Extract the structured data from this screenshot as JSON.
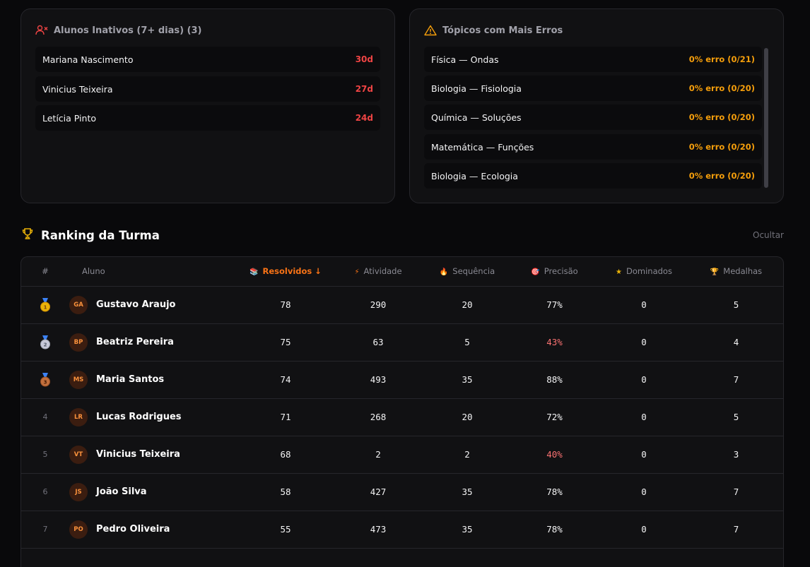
{
  "inactive": {
    "title": "Alunos Inativos (7+ dias) (3)",
    "icon": "user-x-icon",
    "students": [
      {
        "name": "Mariana Nascimento",
        "days": "30d"
      },
      {
        "name": "Vinicius Teixeira",
        "days": "27d"
      },
      {
        "name": "Letícia Pinto",
        "days": "24d"
      }
    ]
  },
  "topics": {
    "title": "Tópicos com Mais Erros",
    "icon": "warning-triangle-icon",
    "items": [
      {
        "name": "Física — Ondas",
        "error": "0% erro (0/21)"
      },
      {
        "name": "Biologia — Fisiologia",
        "error": "0% erro (0/20)"
      },
      {
        "name": "Química — Soluções",
        "error": "0% erro (0/20)"
      },
      {
        "name": "Matemática — Funções",
        "error": "0% erro (0/20)"
      },
      {
        "name": "Biologia — Ecologia",
        "error": "0% erro (0/20)"
      }
    ]
  },
  "ranking": {
    "title": "Ranking da Turma",
    "hide_label": "Ocultar",
    "columns": {
      "pos": "#",
      "student": "Aluno",
      "solved": "Resolvidos ↓",
      "activity": "Atividade",
      "streak": "Sequência",
      "precision": "Precisão",
      "mastered": "Dominados",
      "medals": "Medalhas"
    },
    "rows": [
      {
        "pos": "1",
        "initials": "GA",
        "name": "Gustavo Araujo",
        "solved": "78",
        "activity": "290",
        "streak": "20",
        "precision": "77%",
        "mastered": "0",
        "medals": "5"
      },
      {
        "pos": "2",
        "initials": "BP",
        "name": "Beatriz Pereira",
        "solved": "75",
        "activity": "63",
        "streak": "5",
        "precision": "43%",
        "mastered": "0",
        "medals": "4"
      },
      {
        "pos": "3",
        "initials": "MS",
        "name": "Maria Santos",
        "solved": "74",
        "activity": "493",
        "streak": "35",
        "precision": "88%",
        "mastered": "0",
        "medals": "7"
      },
      {
        "pos": "4",
        "initials": "LR",
        "name": "Lucas Rodrigues",
        "solved": "71",
        "activity": "268",
        "streak": "20",
        "precision": "72%",
        "mastered": "0",
        "medals": "5"
      },
      {
        "pos": "5",
        "initials": "VT",
        "name": "Vinicius Teixeira",
        "solved": "68",
        "activity": "2",
        "streak": "2",
        "precision": "40%",
        "mastered": "0",
        "medals": "3"
      },
      {
        "pos": "6",
        "initials": "JS",
        "name": "João Silva",
        "solved": "58",
        "activity": "427",
        "streak": "35",
        "precision": "78%",
        "mastered": "0",
        "medals": "7"
      },
      {
        "pos": "7",
        "initials": "PO",
        "name": "Pedro Oliveira",
        "solved": "55",
        "activity": "473",
        "streak": "35",
        "precision": "78%",
        "mastered": "0",
        "medals": "7"
      }
    ]
  },
  "colors": {
    "accent": "#f97316",
    "danger": "#ef4444",
    "warning": "#f59e0b",
    "gold": "#eab308"
  }
}
